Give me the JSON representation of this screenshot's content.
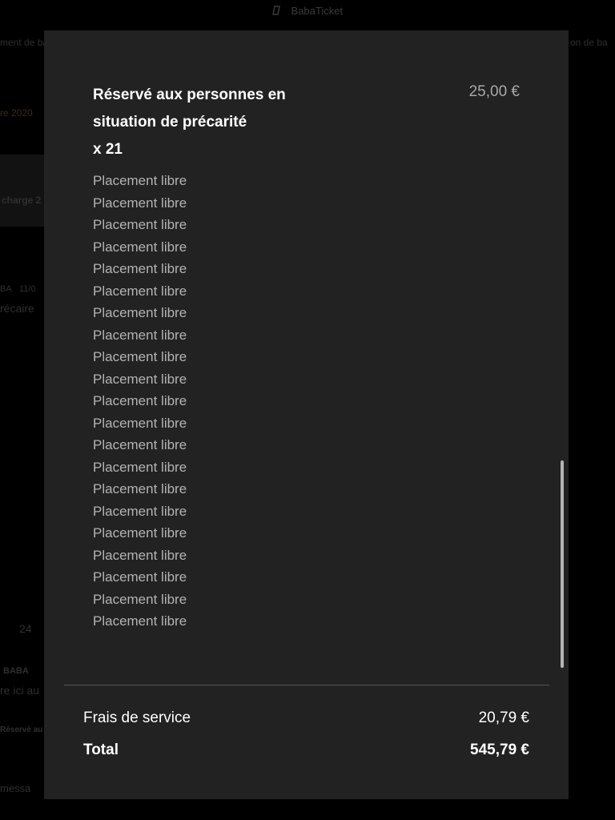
{
  "background": {
    "app_title": "BabaTicket",
    "fragments": [
      "ment de ba",
      "on de ba",
      "re 2020",
      "charge 2",
      "BA",
      "11/0",
      "récaire",
      "24",
      "BABA",
      "re ici au",
      "Réservé au",
      "messa"
    ]
  },
  "modal": {
    "item": {
      "title": "Réservé aux personnes en situation de précarité",
      "quantity": "x 21",
      "price": "25,00 €",
      "placements": [
        "Placement libre",
        "Placement libre",
        "Placement libre",
        "Placement libre",
        "Placement libre",
        "Placement libre",
        "Placement libre",
        "Placement libre",
        "Placement libre",
        "Placement libre",
        "Placement libre",
        "Placement libre",
        "Placement libre",
        "Placement libre",
        "Placement libre",
        "Placement libre",
        "Placement libre",
        "Placement libre",
        "Placement libre",
        "Placement libre",
        "Placement libre"
      ]
    },
    "summary": {
      "fees_label": "Frais de service",
      "fees_value": "20,79 €",
      "total_label": "Total",
      "total_value": "545,79 €"
    }
  }
}
